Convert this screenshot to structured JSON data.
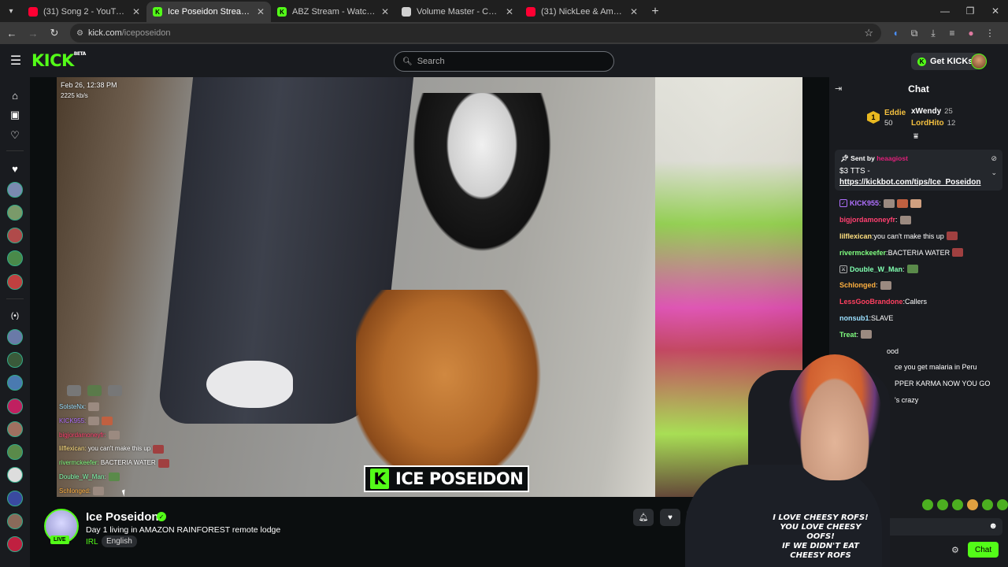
{
  "browser": {
    "tabs": [
      {
        "title": "(31) Song 2 - YouTube",
        "favicon_color": "#ff0033",
        "active": false
      },
      {
        "title": "Ice Poseidon Stream - Watch",
        "favicon_color": "#53fc18",
        "active": true
      },
      {
        "title": "ABZ Stream - Watch Live on Ki",
        "favicon_color": "#53fc18",
        "active": false
      },
      {
        "title": "Volume Master - Chrome Web",
        "favicon_color": "#d0d0d0",
        "active": false
      },
      {
        "title": "(31) NickLee & Amouranth Hav",
        "favicon_color": "#ff0033",
        "active": false
      }
    ],
    "url_host": "kick.com",
    "url_path": "/iceposeidon"
  },
  "header": {
    "logo": "KICK",
    "logo_badge": "BETA",
    "search_placeholder": "Search",
    "get_kicks_label": "Get KICKs",
    "accent": "#53fc18"
  },
  "video": {
    "timestamp": "Feb 26, 12:38 PM",
    "bitrate": "2225 kb/s",
    "brand_overlay": "ICE POSEIDON",
    "overlay_chat": [
      {
        "user": "SolsteNx:",
        "color": "#9be0ff",
        "text": ""
      },
      {
        "user": "KICK955:",
        "color": "#b070ff",
        "text": ""
      },
      {
        "user": "bigjordamoneyfr:",
        "color": "#ff4070",
        "text": ""
      },
      {
        "user": "lilflexican:",
        "color": "#ffe080",
        "text": " you can't make this up"
      },
      {
        "user": "rivermckeefer:",
        "color": "#80ff80",
        "text": " BACTERIA WATER"
      },
      {
        "user": "Double_W_Man:",
        "color": "#80ffb0",
        "text": ""
      },
      {
        "user": "Schlonged:",
        "color": "#ffb040",
        "text": ""
      }
    ]
  },
  "stream": {
    "channel_name": "Ice Poseidon",
    "live_label": "LIVE",
    "title": "Day 1 living in AMAZON RAINFOREST remote lodge",
    "category": "IRL",
    "language": "English"
  },
  "chat": {
    "header": "Chat",
    "leaderboard": [
      {
        "rank": "1",
        "name": "Eddie",
        "value": "50"
      },
      {
        "name": "xWendy",
        "value": "25"
      },
      {
        "name": "LordHito",
        "value": "12"
      }
    ],
    "pinned": {
      "sent_by_label": "Sent by",
      "sender": "heaagiost",
      "tts": "$3 TTS -",
      "link": "https://kickbot.com/tips/Ice_Poseidon"
    },
    "messages": [
      {
        "user": "KICK955",
        "color": "#b070ff",
        "text": ""
      },
      {
        "user": "bigjordamoneyfr",
        "color": "#ff4070",
        "text": ""
      },
      {
        "user": "lilflexican",
        "color": "#ffe080",
        "text": " you can't make this up"
      },
      {
        "user": "rivermckeefer",
        "color": "#80ff80",
        "text": " BACTERIA WATER"
      },
      {
        "user": "Double_W_Man",
        "color": "#80ffb0",
        "text": ""
      },
      {
        "user": "Schlonged",
        "color": "#ffb040",
        "text": ""
      },
      {
        "user": "LessGooBrandone",
        "color": "#ff4060",
        "text": " Callers"
      },
      {
        "user": "nonsub1",
        "color": "#9be0ff",
        "text": " SLAVE"
      },
      {
        "user": "Treat",
        "color": "#80ff80",
        "text": ""
      },
      {
        "user": "",
        "color": "#ffffff",
        "text": "ood"
      },
      {
        "user": "",
        "color": "#ffffff",
        "text": "ce you get malaria in Peru"
      },
      {
        "user": "",
        "color": "#ffffff",
        "text": "PPER KARMA NOW YOU GO"
      },
      {
        "user": "",
        "color": "#ffffff",
        "text": "'s crazy"
      }
    ],
    "send_label": "Chat"
  },
  "webcam": {
    "shirt_lines": [
      "I LOVE CHEESY ROFS!",
      "YOU LOVE CHEESY OOFS!",
      "IF WE DIDN'T EAT",
      "CHEESY ROFS"
    ]
  }
}
